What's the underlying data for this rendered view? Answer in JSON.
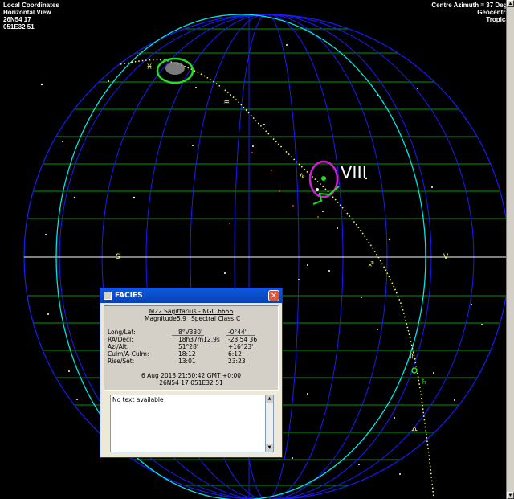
{
  "header": {
    "left_lines": [
      "Local Coordinates",
      "Horizontal View",
      "26N54 17",
      "051E32 51"
    ],
    "right_lines": [
      "Centre Azimuth = 37 Degs",
      "Geocentric",
      "Tropical"
    ]
  },
  "annotation": {
    "roman_numeral": "VIII"
  },
  "dialog": {
    "title": "FACIES",
    "close_glyph": "✕",
    "object_name": "M22 Sagittarius - NGC 6656",
    "magnitude_label": "Magnitude:",
    "magnitude_value": "5.9",
    "spectral_label": "Spectral Class:",
    "spectral_value": "C",
    "rows": [
      {
        "label": "Long/Lat:",
        "v1": "8°V330'",
        "v2": "-0°44'"
      },
      {
        "label": "RA/Decl:",
        "v1": "18h37m12,9s",
        "v2": "-23 54 36"
      },
      {
        "label": "Azi/Alt:",
        "v1": "51°28'",
        "v2": "+16°23'"
      },
      {
        "label": "Culm/A-Culm:",
        "v1": "18:12",
        "v2": "6:12"
      },
      {
        "label": "Rise/Set:",
        "v1": "13:01",
        "v2": "23:23"
      }
    ],
    "datetime": "6 Aug 2013  21:50:42  GMT +0:00",
    "coords": "26N54 17   051E32 51",
    "notes_text": "No text available"
  },
  "colors": {
    "background": "#000000",
    "meridians": "#1a1aff",
    "almucantars": "#00ff00",
    "horizon": "#ffffff",
    "equator_circle": "#00e5e5",
    "ecliptic": "#ffff66",
    "highlight_green": "#22dd22",
    "highlight_magenta": "#cc22cc"
  },
  "icons": {
    "dialog_icon": "window-app-icon",
    "close": "close-icon",
    "scroll_up": "arrow-up-icon",
    "scroll_down": "arrow-down-icon"
  }
}
